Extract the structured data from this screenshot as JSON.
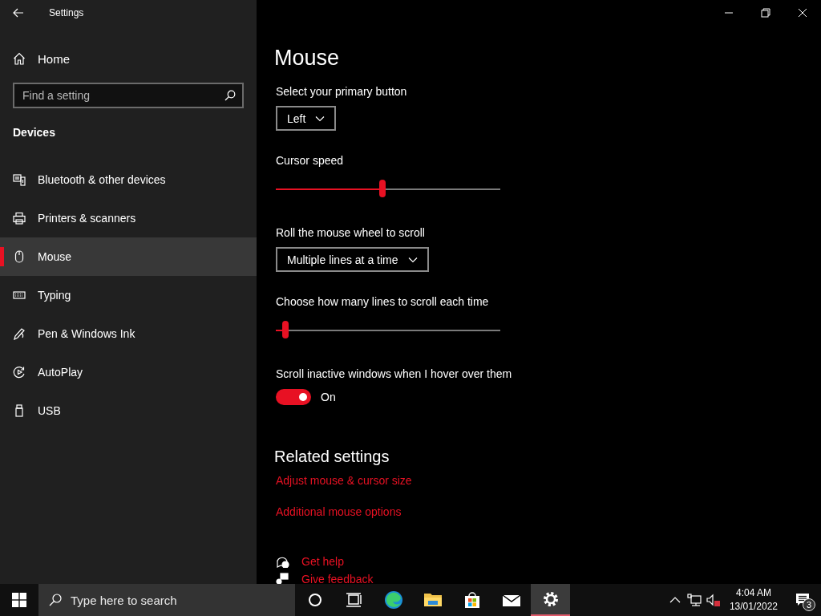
{
  "window": {
    "title": "Settings"
  },
  "sidebar": {
    "home": "Home",
    "search": {
      "placeholder": "Find a setting"
    },
    "section": "Devices",
    "items": [
      {
        "label": "Bluetooth & other devices",
        "selected": false
      },
      {
        "label": "Printers & scanners",
        "selected": false
      },
      {
        "label": "Mouse",
        "selected": true
      },
      {
        "label": "Typing",
        "selected": false
      },
      {
        "label": "Pen & Windows Ink",
        "selected": false
      },
      {
        "label": "AutoPlay",
        "selected": false
      },
      {
        "label": "USB",
        "selected": false
      }
    ]
  },
  "page": {
    "title": "Mouse",
    "primary_button": {
      "label": "Select your primary button",
      "value": "Left"
    },
    "cursor_speed": {
      "label": "Cursor speed",
      "level": 0.475
    },
    "wheel_scroll": {
      "label": "Roll the mouse wheel to scroll",
      "value": "Multiple lines at a time"
    },
    "lines_to_scroll": {
      "label": "Choose how many lines to scroll each time",
      "level": 0.03
    },
    "inactive_scroll": {
      "label": "Scroll inactive windows when I hover over them",
      "on": true,
      "state_text": "On"
    },
    "related": {
      "title": "Related settings",
      "links": [
        "Adjust mouse & cursor size",
        "Additional mouse options"
      ]
    },
    "help_links": [
      "Get help",
      "Give feedback"
    ]
  },
  "taskbar": {
    "search": {
      "placeholder": "Type here to search"
    },
    "apps": [
      {
        "selected": false
      },
      {
        "selected": false
      },
      {
        "selected": false
      },
      {
        "selected": false
      },
      {
        "selected": false
      },
      {
        "selected": false
      },
      {
        "selected": true
      }
    ],
    "clock": {
      "time": "4:04 AM",
      "date": "13/01/2022"
    },
    "notifications": {
      "count": "3"
    }
  }
}
